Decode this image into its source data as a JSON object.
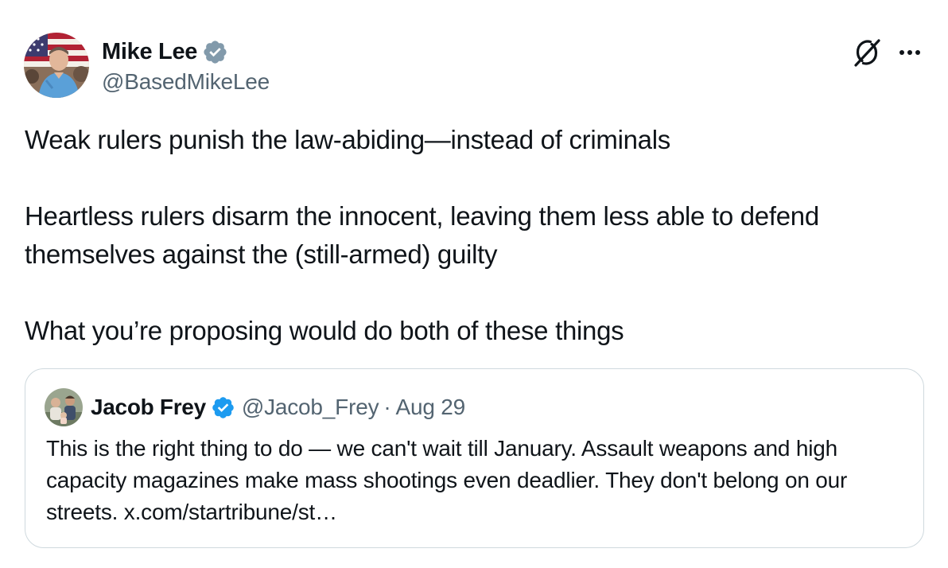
{
  "author": {
    "display_name": "Mike Lee",
    "handle": "@BasedMikeLee",
    "avatar_icon": "avatar-photo",
    "verified_icon": "verified-badge-icon",
    "verified_color": "#829aab"
  },
  "actions": {
    "grok_icon": "grok-icon",
    "more_icon": "more-icon"
  },
  "post": {
    "paragraphs": [
      "Weak rulers punish the law-abiding—instead of criminals",
      "Heartless rulers disarm the innocent, leaving them less able to defend themselves against the (still-armed) guilty",
      "What you’re proposing would do both of these things"
    ]
  },
  "quoted": {
    "display_name": "Jacob Frey",
    "handle": "@Jacob_Frey",
    "separator": "·",
    "date": "Aug 29",
    "verified_color": "#1d9bf0",
    "text": "This is the right thing to do — we can't wait till January. Assault weapons and high capacity magazines make mass shootings even deadlier. They don't belong on our streets. x.com/startribune/st…"
  },
  "colors": {
    "text": "#0f1419",
    "secondary": "#536471",
    "border": "#cfd9de"
  }
}
